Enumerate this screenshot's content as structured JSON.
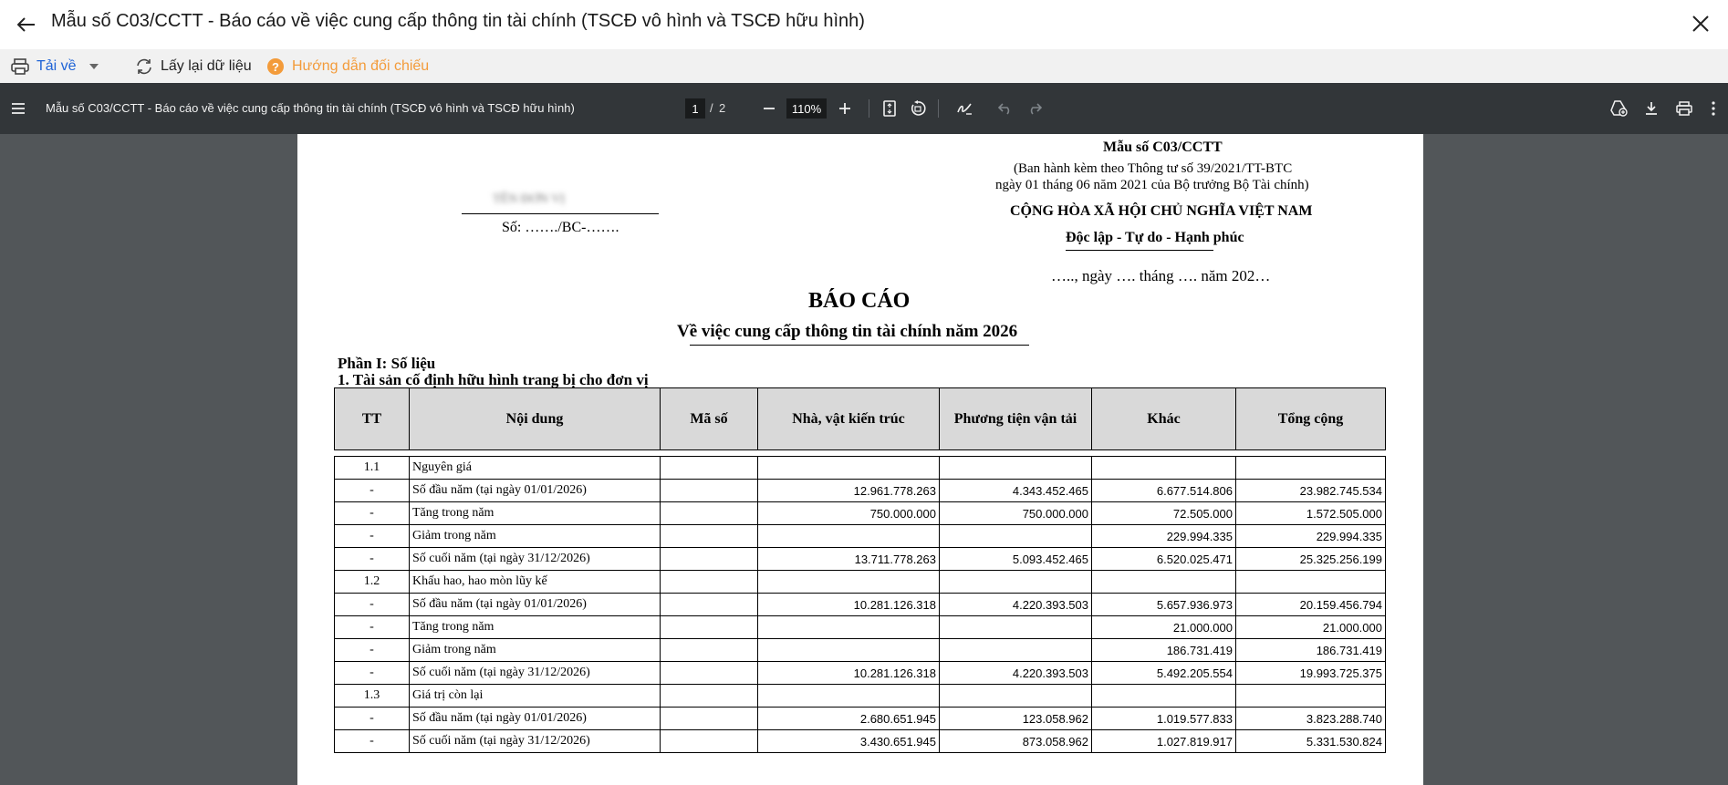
{
  "window": {
    "title": "Mẫu số C03/CCTT - Báo cáo về việc cung cấp thông tin tài chính (TSCĐ vô hình và TSCĐ hữu hình)"
  },
  "toolbar": {
    "download_label": "Tải về",
    "reload_label": "Lấy lại dữ liệu",
    "guide_label": "Hướng dẫn đối chiếu",
    "guide_color": "#f39b3a",
    "download_color": "#1e63d6"
  },
  "pdf_toolbar": {
    "doc_title": "Mẫu số C03/CCTT - Báo cáo về việc cung cấp thông tin tài chính (TSCĐ vô hình và TSCĐ hữu hình)",
    "page_current": "1",
    "page_sep": "/",
    "page_total": "2",
    "zoom": "110%"
  },
  "document": {
    "form_code": "Mẫu số C03/CCTT",
    "issued_line1": "(Ban hành kèm theo Thông tư số 39/2021/TT-BTC",
    "issued_line2": "ngày 01 tháng 06 năm 2021 của Bộ trưởng Bộ Tài chính)",
    "unit_name_redacted": "TÊN ĐƠN VỊ",
    "report_no": "Số:  ……./BC-…….",
    "nation": "CỘNG HÒA XÃ HỘI CHỦ NGHĨA VIỆT NAM",
    "motto": "Độc lập - Tự do - Hạnh phúc",
    "date_line": "….., ngày …. tháng …. năm 202…",
    "title": "BÁO CÁO",
    "subtitle": "Về việc cung cấp thông tin tài chính năm 2026",
    "part1": "Phần I: Số liệu",
    "section1": "1. Tài sản cố định hữu hình trang bị cho đơn vị"
  },
  "table": {
    "headers": [
      "TT",
      "Nội dung",
      "Mã số",
      "Nhà, vật kiến trúc",
      "Phương tiện vận tải",
      "Khác",
      "Tổng cộng"
    ],
    "rows": [
      {
        "tt": "1.1",
        "content": "Nguyên giá",
        "code": "",
        "nha": "",
        "pt": "",
        "khac": "",
        "tong": ""
      },
      {
        "tt": "-",
        "content": "Số đầu năm (tại ngày 01/01/2026)",
        "code": "",
        "nha": "12.961.778.263",
        "pt": "4.343.452.465",
        "khac": "6.677.514.806",
        "tong": "23.982.745.534"
      },
      {
        "tt": "-",
        "content": "Tăng trong năm",
        "code": "",
        "nha": "750.000.000",
        "pt": "750.000.000",
        "khac": "72.505.000",
        "tong": "1.572.505.000"
      },
      {
        "tt": "-",
        "content": "Giảm trong năm",
        "code": "",
        "nha": "",
        "pt": "",
        "khac": "229.994.335",
        "tong": "229.994.335"
      },
      {
        "tt": "-",
        "content": "Số cuối năm (tại ngày 31/12/2026)",
        "code": "",
        "nha": "13.711.778.263",
        "pt": "5.093.452.465",
        "khac": "6.520.025.471",
        "tong": "25.325.256.199"
      },
      {
        "tt": "1.2",
        "content": "Khấu hao, hao mòn lũy kế",
        "code": "",
        "nha": "",
        "pt": "",
        "khac": "",
        "tong": ""
      },
      {
        "tt": "-",
        "content": "Số đầu năm (tại ngày 01/01/2026)",
        "code": "",
        "nha": "10.281.126.318",
        "pt": "4.220.393.503",
        "khac": "5.657.936.973",
        "tong": "20.159.456.794"
      },
      {
        "tt": "-",
        "content": "Tăng trong năm",
        "code": "",
        "nha": "",
        "pt": "",
        "khac": "21.000.000",
        "tong": "21.000.000"
      },
      {
        "tt": "-",
        "content": "Giảm trong năm",
        "code": "",
        "nha": "",
        "pt": "",
        "khac": "186.731.419",
        "tong": "186.731.419"
      },
      {
        "tt": "-",
        "content": "Số cuối năm (tại ngày 31/12/2026)",
        "code": "",
        "nha": "10.281.126.318",
        "pt": "4.220.393.503",
        "khac": "5.492.205.554",
        "tong": "19.993.725.375"
      },
      {
        "tt": "1.3",
        "content": "Giá trị còn lại",
        "code": "",
        "nha": "",
        "pt": "",
        "khac": "",
        "tong": ""
      },
      {
        "tt": "-",
        "content": "Số đầu năm (tại ngày 01/01/2026)",
        "code": "",
        "nha": "2.680.651.945",
        "pt": "123.058.962",
        "khac": "1.019.577.833",
        "tong": "3.823.288.740"
      },
      {
        "tt": "-",
        "content": "Số cuối năm (tại ngày 31/12/2026)",
        "code": "",
        "nha": "3.430.651.945",
        "pt": "873.058.962",
        "khac": "1.027.819.917",
        "tong": "5.331.530.824"
      }
    ]
  }
}
